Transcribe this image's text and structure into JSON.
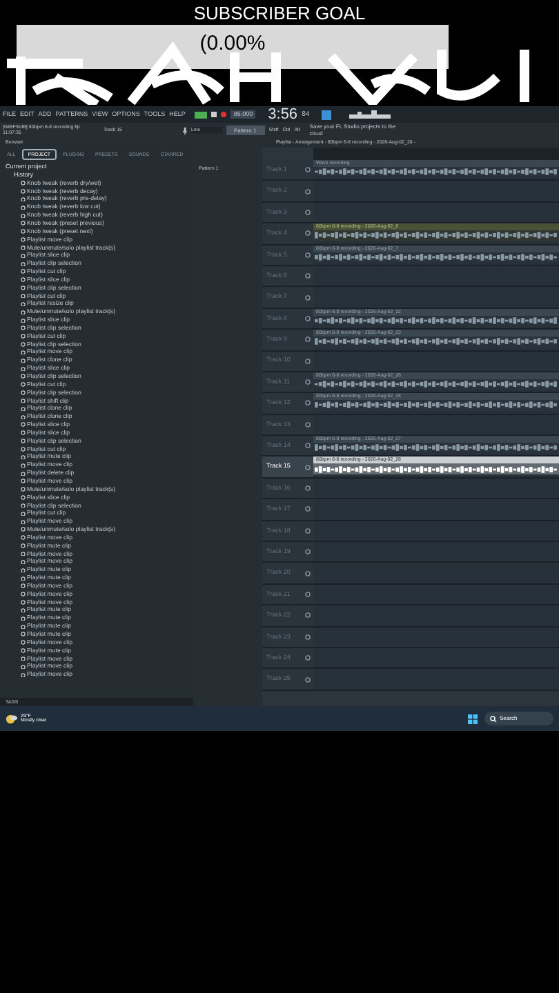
{
  "overlay": {
    "title": "SUBSCRIBER GOAL",
    "progress_text": "(0.00%",
    "level": 0
  },
  "menu": [
    "FILE",
    "EDIT",
    "ADD",
    "PATTERNS",
    "VIEW",
    "OPTIONS",
    "TOOLS",
    "HELP"
  ],
  "transport": {
    "tempo": "86.000",
    "time": "3:56",
    "time_sub": "84",
    "pattern": "Pattern 1",
    "input": "Line",
    "modifiers": [
      "Shift",
      "Ctrl",
      "Alt"
    ],
    "news": "Save your FL Studio projects to the cloud"
  },
  "hint": {
    "file": "[0dBFS/dB] 80bpm 6-8 recording.flp",
    "time": "11:07:35",
    "track": "Track 15"
  },
  "browser": {
    "title": "Browser",
    "tabs": [
      {
        "label": "ALL",
        "selected": false
      },
      {
        "label": "PROJECT",
        "selected": true
      },
      {
        "label": "PLUGINS",
        "selected": false
      },
      {
        "label": "PRESETS",
        "selected": false
      },
      {
        "label": "SOUNDS",
        "selected": false
      },
      {
        "label": "STARRED",
        "selected": false
      }
    ],
    "tree": {
      "label": "Current project",
      "children": [
        {
          "label": "History",
          "children": [
            "Knob tweak (reverb dry/wet)",
            "Knob tweak (reverb decay)",
            "Knob tweak (reverb pre-delay)",
            "Knob tweak (reverb low cut)",
            "Knob tweak (reverb high cut)",
            "Knob tweak (preset previous)",
            "Knob tweak (preset next)",
            "Playlist move clip",
            "Mute/unmute/solo playlist track(s)",
            "Playlist slice clip",
            "Playlist clip selection",
            "Playlist cut clip",
            "Playlist slice clip",
            "Playlist clip selection",
            "Playlist cut clip",
            "Playlist resize clip",
            "Mute/unmute/solo playlist track(s)",
            "Playlist slice clip",
            "Playlist clip selection",
            "Playlist cut clip",
            "Playlist clip selection",
            "Playlist move clip",
            "Playlist clone clip",
            "Playlist slice clip",
            "Playlist clip selection",
            "Playlist cut clip",
            "Playlist clip selection",
            "Playlist shift clip",
            "Playlist clone clip",
            "Playlist clone clip",
            "Playlist slice clip",
            "Playlist slice clip",
            "Playlist clip selection",
            "Playlist cut clip",
            "Playlist mute clip",
            "Playlist move clip",
            "Playlist delete clip",
            "Playlist move clip",
            "Mute/unmute/solo playlist track(s)",
            "Playlist slice clip",
            "Playlist clip selection",
            "Playlist cut clip",
            "Playlist move clip",
            "Mute/unmute/solo playlist track(s)",
            "Playlist move clip",
            "Playlist mute clip",
            "Playlist move clip",
            "Playlist move clip",
            "Playlist mute clip",
            "Playlist mute clip",
            "Playlist move clip",
            "Playlist move clip",
            "Playlist move clip",
            "Playlist mute clip",
            "Playlist mute clip",
            "Playlist mute clip",
            "Playlist mute clip",
            "Playlist move clip",
            "Playlist mute clip",
            "Playlist move clip",
            "Playlist move clip",
            "Playlist move clip"
          ]
        }
      ]
    },
    "tags": "TAGS"
  },
  "playlist": {
    "title": "Playlist - Arrangement - 80bpm 6-8 recording - 2026-Aug-02_28 -",
    "pattern": "Pattern 1",
    "tracks": [
      {
        "name": "Track 1",
        "selected": false,
        "clip": {
          "label": "Wave recording",
          "kind": "normal"
        }
      },
      {
        "name": "Track 2",
        "selected": false
      },
      {
        "name": "Track 3",
        "selected": false
      },
      {
        "name": "Track 4",
        "selected": false,
        "clip": {
          "label": "80bpm 6-8 recording - 2026-Aug-02_6",
          "kind": "tinted"
        }
      },
      {
        "name": "Track 5",
        "selected": false,
        "clip": {
          "label": "80bpm 6-8 recording - 2026-Aug-02_7",
          "kind": "normal"
        }
      },
      {
        "name": "Track 6",
        "selected": false
      },
      {
        "name": "Track 7",
        "selected": false
      },
      {
        "name": "Track 8",
        "selected": false,
        "clip": {
          "label": "80bpm 6-8 recording - 2026-Aug-02_22",
          "kind": "normal"
        }
      },
      {
        "name": "Track 9",
        "selected": false,
        "clip": {
          "label": "80bpm 6-8 recording - 2026-Aug-02_23",
          "kind": "normal"
        }
      },
      {
        "name": "Track 10",
        "selected": false
      },
      {
        "name": "Track 11",
        "selected": false,
        "clip": {
          "label": "80bpm 6-8 recording - 2026-Aug-02_26",
          "kind": "normal"
        }
      },
      {
        "name": "Track 12",
        "selected": false,
        "clip": {
          "label": "80bpm 6-8 recording - 2026-Aug-02_28",
          "kind": "normal"
        }
      },
      {
        "name": "Track 13",
        "selected": false
      },
      {
        "name": "Track 14",
        "selected": false,
        "clip": {
          "label": "80bpm 6-8 recording - 2026-Aug-02_27",
          "kind": "normal"
        }
      },
      {
        "name": "Track 15",
        "selected": true,
        "clip": {
          "label": "80bpm 6-8 recording - 2026-Aug-02_28",
          "kind": "selected"
        }
      },
      {
        "name": "Track 16",
        "selected": false
      },
      {
        "name": "Track 17",
        "selected": false
      },
      {
        "name": "Track 18",
        "selected": false
      },
      {
        "name": "Track 19",
        "selected": false
      },
      {
        "name": "Track 20",
        "selected": false
      },
      {
        "name": "Track 21",
        "selected": false
      },
      {
        "name": "Track 22",
        "selected": false
      },
      {
        "name": "Track 23",
        "selected": false
      },
      {
        "name": "Track 24",
        "selected": false
      },
      {
        "name": "Track 25",
        "selected": false
      }
    ]
  },
  "taskbar": {
    "weather_temp": "29°F",
    "weather_text": "Mostly clear",
    "search": "Search"
  }
}
